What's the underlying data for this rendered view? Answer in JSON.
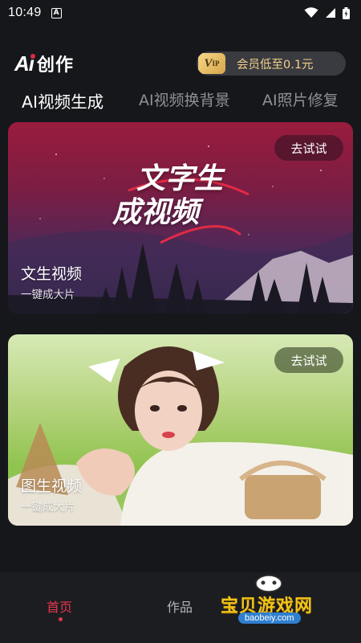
{
  "status": {
    "time": "10:49",
    "notification_icon": "a-icon"
  },
  "header": {
    "logo_ai": "Ai",
    "logo_text": "创作",
    "vip_badge": "VIP",
    "vip_text": "会员低至0.1元"
  },
  "tabs": [
    {
      "label": "AI视频生成",
      "active": true
    },
    {
      "label": "AI视频换背景",
      "active": false
    },
    {
      "label": "AI照片修复",
      "active": false
    }
  ],
  "cards": [
    {
      "title": "文生视频",
      "subtitle": "一键成大片",
      "button": "去试试",
      "art_line1": "文字生",
      "art_line2": "成视频"
    },
    {
      "title": "图生视频",
      "subtitle": "一键成大片",
      "button": "去试试"
    }
  ],
  "nav": {
    "home": "首页",
    "works": "作品"
  },
  "watermark": {
    "title": "宝贝游戏网",
    "url": "baobeiy.com"
  },
  "colors": {
    "accent": "#e4364d",
    "gold": "#f3d18e",
    "background": "#16171b"
  }
}
